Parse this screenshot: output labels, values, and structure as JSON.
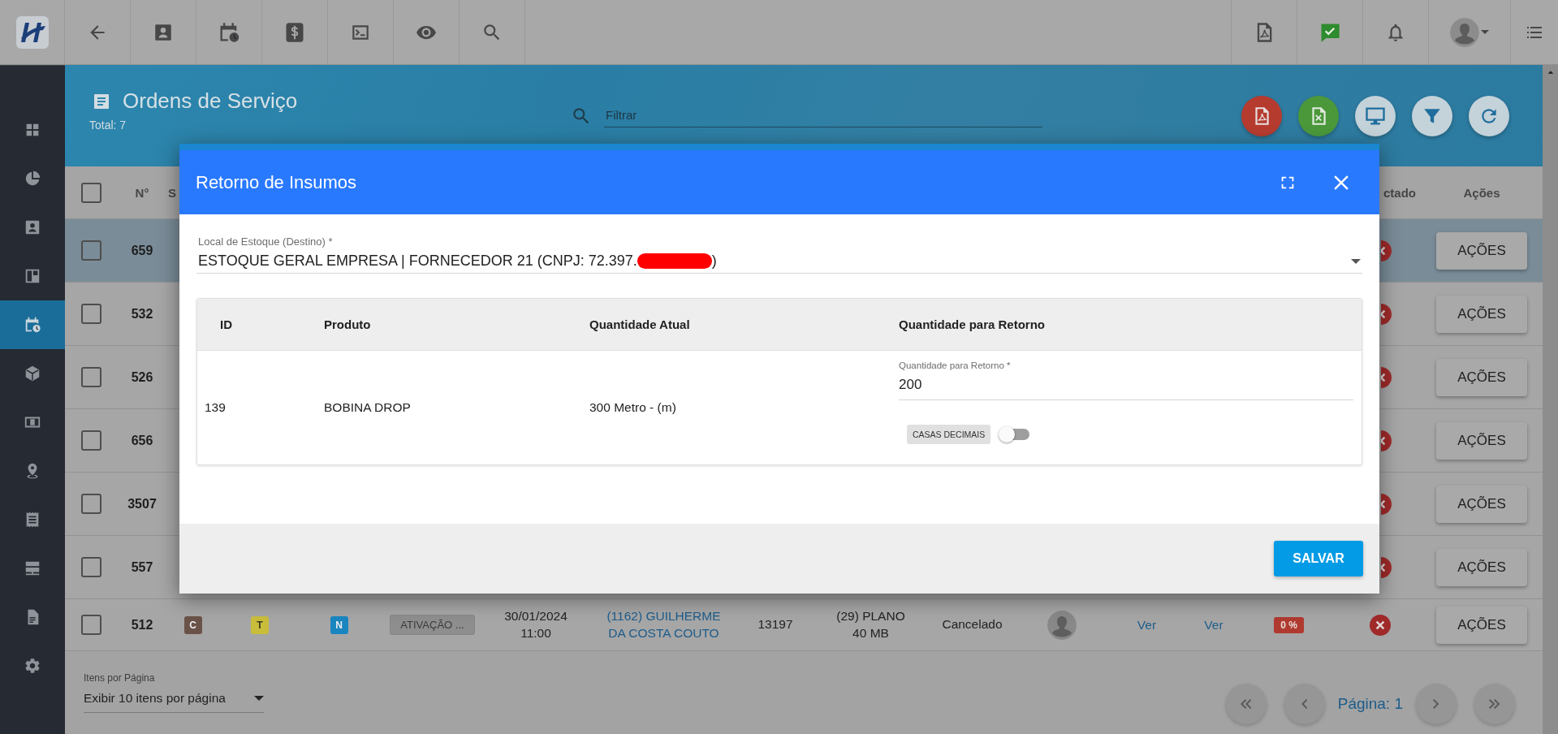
{
  "sidebar": {
    "items": [
      {
        "kind": "grid",
        "selected": false
      },
      {
        "kind": "pie",
        "selected": false
      },
      {
        "kind": "contact",
        "selected": false
      },
      {
        "kind": "board",
        "selected": false
      },
      {
        "kind": "calendar",
        "selected": true
      },
      {
        "kind": "box",
        "selected": false
      },
      {
        "kind": "money",
        "selected": false
      },
      {
        "kind": "pin",
        "selected": false
      },
      {
        "kind": "receipt",
        "selected": false
      },
      {
        "kind": "server",
        "selected": false
      },
      {
        "kind": "document",
        "selected": false
      },
      {
        "kind": "gear",
        "selected": false
      }
    ]
  },
  "page": {
    "title": "Ordens de Serviço",
    "total": "Total: 7",
    "search": {
      "placeholder": "Filtrar"
    }
  },
  "table": {
    "select_all": {
      "checked": false
    },
    "columns": [
      "N°",
      "S",
      "ctado",
      "Ações"
    ],
    "rows": [
      {
        "number": "659",
        "selected": true,
        "checked": false,
        "action": "AÇÕES"
      },
      {
        "number": "532",
        "selected": false,
        "checked": false,
        "action": "AÇÕES"
      },
      {
        "number": "526",
        "selected": false,
        "checked": false,
        "action": "AÇÕES"
      },
      {
        "number": "656",
        "selected": false,
        "checked": false,
        "action": "AÇÕES"
      },
      {
        "number": "3507",
        "selected": false,
        "checked": false,
        "action": "AÇÕES"
      },
      {
        "number": "557",
        "selected": false,
        "checked": false,
        "action": "AÇÕES"
      },
      {
        "number": "512",
        "selected": false,
        "checked": false,
        "tags": [
          {
            "label": "C",
            "color": "#6b5249"
          },
          {
            "label": "T",
            "color": "#c9bd3c"
          },
          {
            "label": "N",
            "color": "#1a86c0"
          }
        ],
        "category": "ATIVAÇÃO ...",
        "date": "30/01/2024 11:00",
        "client": "(1162) GUILHERME DA COSTA COUTO",
        "code": "13197",
        "plan": "(29) PLANO 40 MB",
        "status": "Cancelado",
        "links": [
          "Ver",
          "Ver"
        ],
        "progress": "0 %",
        "action": "AÇÕES"
      }
    ]
  },
  "pagination": {
    "page_size": {
      "label": "Itens por Página",
      "value": "Exibir 10 itens por página"
    },
    "page": "Página: 1"
  },
  "dialog": {
    "title": "Retorno de Insumos",
    "location_field": {
      "label": "Local de Estoque (Destino) *",
      "value": "ESTOQUE GERAL EMPRESA | FORNECEDOR 21 (CNPJ: 72.397.",
      "value_end": ")"
    },
    "columns": [
      "ID",
      "Produto",
      "Quantidade Atual",
      "Quantidade para Retorno"
    ],
    "items": [
      {
        "id": "139",
        "product": "BOBINA DROP",
        "current": "300 Metro - (m)",
        "return_field": {
          "label": "Quantidade para Retorno *",
          "value": "200"
        },
        "decimals": {
          "label": "CASAS DECIMAIS",
          "on": false
        }
      }
    ],
    "save": "SALVAR"
  }
}
